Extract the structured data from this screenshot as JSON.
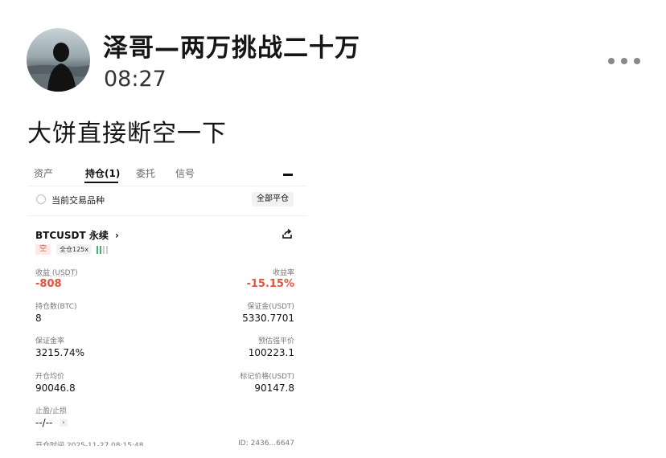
{
  "post": {
    "author": "泽哥—两万挑战二十万",
    "time": "08:27",
    "text": "大饼直接断空一下"
  },
  "screenshot": {
    "tabs": [
      "资产",
      "持仓(1)",
      "委托",
      "信号"
    ],
    "active_tab_index": 1,
    "current_label": "当前交易品种",
    "close_all_label": "全部平仓",
    "symbol": "BTCUSDT 永续",
    "side_tag": "空",
    "leverage_tag": "全仓125x",
    "fields": {
      "pnl_label": "收益 (USDT)",
      "pnl_value": "-808",
      "roe_label": "收益率",
      "roe_value": "-15.15%",
      "size_label": "持仓数(BTC)",
      "size_value": "8",
      "margin_label": "保证金(USDT)",
      "margin_value": "5330.7701",
      "margin_ratio_label": "保证金率",
      "margin_ratio_value": "3215.74%",
      "liq_label": "预估强平价",
      "liq_value": "100223.1",
      "entry_label": "开仓均价",
      "entry_value": "90046.8",
      "mark_label": "标记价格(USDT)",
      "mark_value": "90147.8",
      "tpsl_label": "止盈/止损",
      "tpsl_value": "--/--"
    },
    "bottom_left": "开仓时间 2025-11-27 08:15:48",
    "bottom_right": "ID: 2436...6647"
  },
  "colors": {
    "loss_red": "#e2533d",
    "signal_green": "#3cb371"
  },
  "icons": [
    "more-icon",
    "share-icon",
    "chevron-right-icon",
    "signal-icon"
  ]
}
